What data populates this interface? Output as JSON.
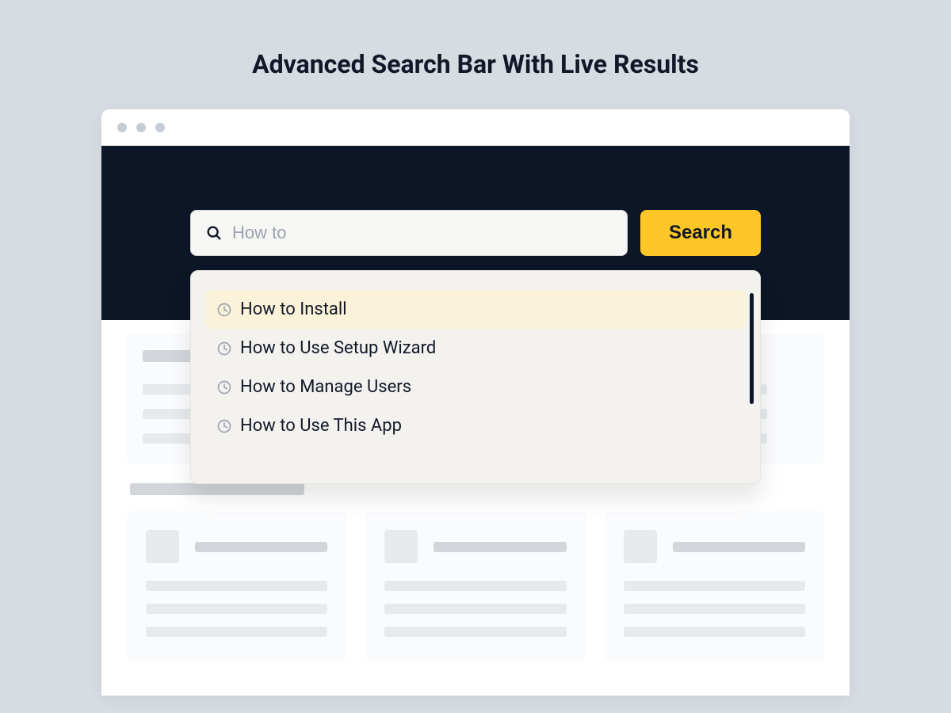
{
  "page_title": "Advanced Search Bar With Live Results",
  "search": {
    "value": "How to",
    "button_label": "Search"
  },
  "suggestions": [
    {
      "label": "How to Install",
      "selected": true
    },
    {
      "label": "How to Use Setup Wizard",
      "selected": false
    },
    {
      "label": "How to Manage Users",
      "selected": false
    },
    {
      "label": "How to Use This App",
      "selected": false
    }
  ]
}
